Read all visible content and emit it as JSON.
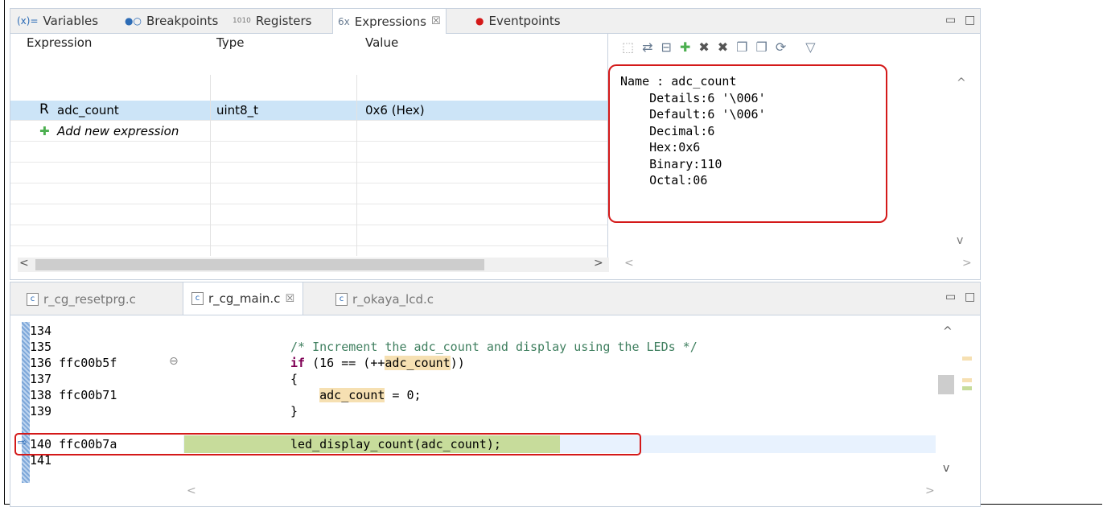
{
  "top_tabs": [
    {
      "icon": "(x)=",
      "label": "Variables"
    },
    {
      "icon": "breakpoints",
      "label": "Breakpoints"
    },
    {
      "icon": "registers",
      "label": "Registers"
    },
    {
      "icon": "expressions",
      "label": "Expressions",
      "active": true,
      "close": "☒"
    },
    {
      "icon": "eventpoints",
      "label": "Eventpoints"
    }
  ],
  "expressions": {
    "headers": {
      "expression": "Expression",
      "type": "Type",
      "value": "Value"
    },
    "rows": [
      {
        "prefix": "R",
        "name": "adc_count",
        "type": "uint8_t",
        "value": "0x6 (Hex)"
      },
      {
        "prefix": "+",
        "name": "Add new expression",
        "type": "",
        "value": ""
      }
    ],
    "details_text": "Name : adc_count\n    Details:6 '\\006'\n    Default:6 '\\006'\n    Decimal:6\n    Hex:0x6\n    Binary:110\n    Octal:06"
  },
  "editor_tabs": [
    {
      "label": "r_cg_resetprg.c"
    },
    {
      "label": "r_cg_main.c",
      "active": true,
      "close": "☒"
    },
    {
      "label": "r_okaya_lcd.c"
    }
  ],
  "code_lines": [
    {
      "num": "134",
      "addr": "",
      "code": ""
    },
    {
      "num": "135",
      "addr": "",
      "code": "/* Increment the adc_count and display using the LEDs */"
    },
    {
      "num": "136",
      "addr": "ffc00b5f",
      "code": "if (16 == (++adc_count))"
    },
    {
      "num": "137",
      "addr": "",
      "code": "{"
    },
    {
      "num": "138",
      "addr": "ffc00b71",
      "code": "    adc_count = 0;"
    },
    {
      "num": "139",
      "addr": "",
      "code": "}"
    },
    {
      "num": "140",
      "addr": "ffc00b7a",
      "code": "led_display_count(adc_count);"
    },
    {
      "num": "141",
      "addr": "",
      "code": ""
    }
  ],
  "colors": {
    "highlight_red": "#d41919",
    "current_line": "#c7dc9b"
  }
}
